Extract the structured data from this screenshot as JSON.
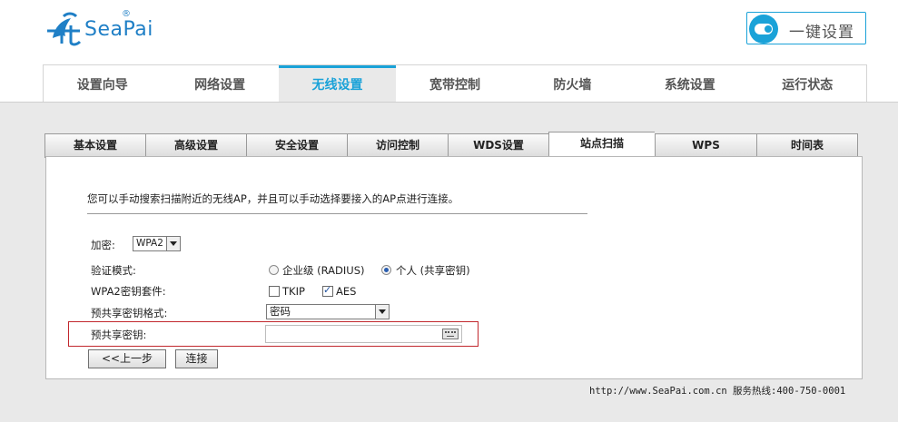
{
  "brand": {
    "name": "SeaPai",
    "reg_mark": "®",
    "accent": "#1aa2d8",
    "logo_color": "#1f7fc6"
  },
  "onekey": {
    "label": "一键设置"
  },
  "main_nav": [
    {
      "label": "设置向导"
    },
    {
      "label": "网络设置"
    },
    {
      "label": "无线设置",
      "active": true
    },
    {
      "label": "宽带控制"
    },
    {
      "label": "防火墙"
    },
    {
      "label": "系统设置"
    },
    {
      "label": "运行状态"
    }
  ],
  "sub_tabs": [
    {
      "label": "基本设置"
    },
    {
      "label": "高级设置"
    },
    {
      "label": "安全设置"
    },
    {
      "label": "访问控制"
    },
    {
      "label": "WDS设置"
    },
    {
      "label": "站点扫描",
      "active": true
    },
    {
      "label": "WPS"
    },
    {
      "label": "时间表"
    }
  ],
  "intro": "您可以手动搜索扫描附近的无线AP，并且可以手动选择要接入的AP点进行连接。",
  "form": {
    "encryption_label": "加密:",
    "encryption_value": "WPA2",
    "auth_mode_label": "验证模式:",
    "auth_enterprise": "企业级 (RADIUS)",
    "auth_personal": "个人 (共享密钥)",
    "cipher_label": "WPA2密钥套件:",
    "cipher_tkip": "TKIP",
    "cipher_aes": "AES",
    "key_format_label": "预共享密钥格式:",
    "key_format_value": "密码",
    "psk_label": "预共享密钥:",
    "psk_value": ""
  },
  "buttons": {
    "prev": "<<上一步",
    "connect": "连接"
  },
  "footer": "http://www.SeaPai.com.cn 服务热线:400-750-0001"
}
